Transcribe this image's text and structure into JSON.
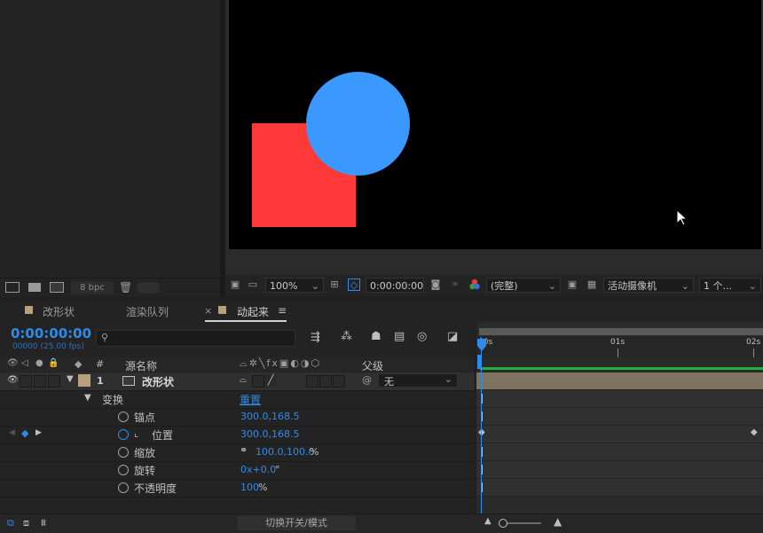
{
  "project": {
    "bit_depth": "8 bpc"
  },
  "viewer": {
    "zoom": "100%",
    "timecode": "0:00:00:00",
    "resolution": "(完整)",
    "camera": "活动摄像机",
    "views": "1 个..."
  },
  "tabs": [
    {
      "label": "改形状"
    },
    {
      "label": "渲染队列"
    },
    {
      "label": "动起来",
      "active": true
    }
  ],
  "timeline": {
    "timecode": "0:00:00:00",
    "fps": "00000 (25.00 fps)",
    "search_placeholder": "",
    "col_hash": "#",
    "col_source_name": "源名称",
    "col_parent": "父级",
    "ruler": [
      "00s",
      "01s",
      "02s"
    ],
    "layer": {
      "index": "1",
      "name": "改形状",
      "parent": "无"
    },
    "transform_label": "变换",
    "reset_label": "重置",
    "properties": [
      {
        "name": "锚点",
        "value": "300.0,168.5",
        "unit": ""
      },
      {
        "name": "位置",
        "value": "300.0,168.5",
        "unit": ""
      },
      {
        "name": "缩放",
        "value": "100.0,100.0",
        "unit": "%"
      },
      {
        "name": "旋转",
        "value": "0x+0.0",
        "unit": "°"
      },
      {
        "name": "不透明度",
        "value": "100",
        "unit": "%"
      }
    ],
    "toggle_modes": "切换开关/模式"
  },
  "colors": {
    "accent": "#2d8ceb",
    "square": "#ff3838",
    "circle": "#3b98ff",
    "label": "#b8a07e",
    "work_area": "#23b23b"
  }
}
